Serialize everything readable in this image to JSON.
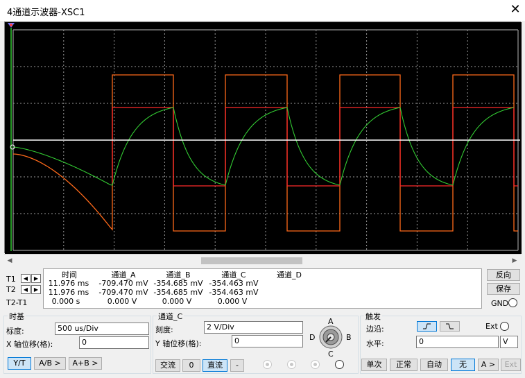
{
  "window": {
    "title": "4通道示波器-XSC1",
    "close_glyph": "✕"
  },
  "readout": {
    "headers": [
      "时间",
      "通道_A",
      "通道_B",
      "通道_C",
      "通道_D"
    ],
    "rows": [
      {
        "label": "T1",
        "values": [
          "11.976 ms",
          "-709.470 mV",
          "-354.685 mV",
          "-354.463 mV"
        ]
      },
      {
        "label": "T2",
        "values": [
          "11.976 ms",
          "-709.470 mV",
          "-354.685 mV",
          "-354.463 mV"
        ]
      },
      {
        "label": "T2-T1",
        "values": [
          "0.000 s",
          "0.000 V",
          "0.000 V",
          "0.000 V"
        ]
      }
    ],
    "arrow_left": "◀",
    "arrow_right": "▶"
  },
  "side_buttons": {
    "reverse": "反向",
    "save": "保存",
    "gnd": "GND"
  },
  "timebase": {
    "title": "时基",
    "scale_label": "标度:",
    "scale_value": "500 us/Div",
    "xpos_label": "X 轴位移(格):",
    "xpos_value": "0",
    "modes": [
      "Y/T",
      "A/B >",
      "A+B >"
    ]
  },
  "channel": {
    "title": "通道_C",
    "scale_label": "刻度:",
    "scale_value": "2  V/Div",
    "ypos_label": "Y 轴位移(格):",
    "ypos_value": "0",
    "coupling": [
      "交流",
      "0",
      "直流",
      "-"
    ],
    "knob_labels": {
      "a": "A",
      "b": "B",
      "c": "C",
      "d": "D"
    }
  },
  "trigger": {
    "title": "触发",
    "edge_label": "边沿:",
    "edge_rise": "ꜰ",
    "edge_fall": "ʅ",
    "ext_label": "Ext",
    "level_label": "水平:",
    "level_value": "0",
    "level_unit": "V",
    "modes": [
      "单次",
      "正常",
      "自动",
      "无",
      "A >",
      "Ext"
    ]
  },
  "colors": {
    "screen_bg": "#000000",
    "grid": "#9a9a9a",
    "channel_a": "#ff6a1a",
    "channel_b": "#ff2a2a",
    "channel_c": "#33cc33",
    "trigger_trace": "#ffffff",
    "marker": "#7070ff"
  }
}
